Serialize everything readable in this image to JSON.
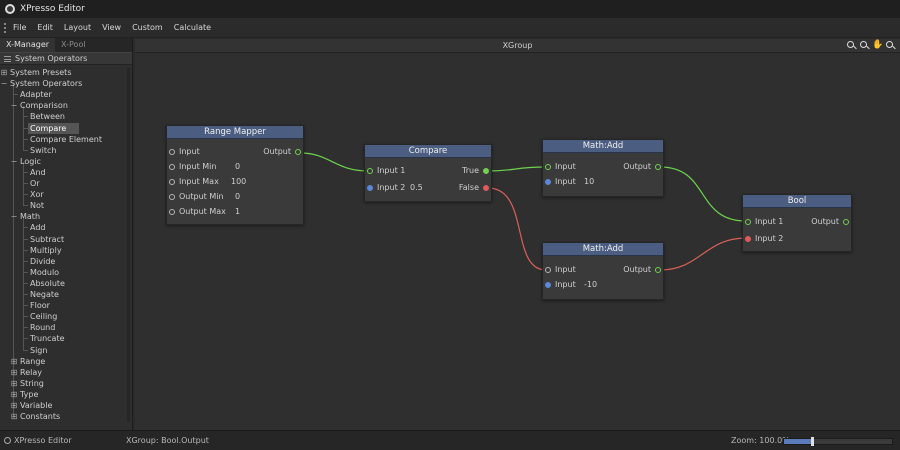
{
  "app": {
    "title": "XPresso Editor"
  },
  "menu": [
    "File",
    "Edit",
    "Layout",
    "View",
    "Custom",
    "Calculate"
  ],
  "left_panel": {
    "tabs": [
      {
        "label": "X-Manager",
        "active": true
      },
      {
        "label": "X-Pool",
        "active": false
      }
    ],
    "header": "System Operators",
    "tree": [
      {
        "label": "System Presets",
        "level": 1,
        "toggle": "plus"
      },
      {
        "label": "System Operators",
        "level": 1,
        "toggle": "minus"
      },
      {
        "label": "Adapter",
        "level": 2
      },
      {
        "label": "Comparison",
        "level": 2,
        "toggle": "minus"
      },
      {
        "label": "Between",
        "level": 3
      },
      {
        "label": "Compare",
        "level": 3,
        "selected": true
      },
      {
        "label": "Compare Element",
        "level": 3
      },
      {
        "label": "Switch",
        "level": 3
      },
      {
        "label": "Logic",
        "level": 2,
        "toggle": "minus"
      },
      {
        "label": "And",
        "level": 3
      },
      {
        "label": "Or",
        "level": 3
      },
      {
        "label": "Xor",
        "level": 3
      },
      {
        "label": "Not",
        "level": 3
      },
      {
        "label": "Math",
        "level": 2,
        "toggle": "minus"
      },
      {
        "label": "Add",
        "level": 3
      },
      {
        "label": "Subtract",
        "level": 3
      },
      {
        "label": "Multiply",
        "level": 3
      },
      {
        "label": "Divide",
        "level": 3
      },
      {
        "label": "Modulo",
        "level": 3
      },
      {
        "label": "Absolute",
        "level": 3
      },
      {
        "label": "Negate",
        "level": 3
      },
      {
        "label": "Floor",
        "level": 3
      },
      {
        "label": "Ceiling",
        "level": 3
      },
      {
        "label": "Round",
        "level": 3
      },
      {
        "label": "Truncate",
        "level": 3
      },
      {
        "label": "Sign",
        "level": 3
      },
      {
        "label": "Range",
        "level": 2,
        "toggle": "plus"
      },
      {
        "label": "Relay",
        "level": 2,
        "toggle": "plus"
      },
      {
        "label": "String",
        "level": 2,
        "toggle": "plus"
      },
      {
        "label": "Type",
        "level": 2,
        "toggle": "plus"
      },
      {
        "label": "Variable",
        "level": 2,
        "toggle": "plus"
      },
      {
        "label": "Constants",
        "level": 2,
        "toggle": "plus"
      }
    ]
  },
  "graph": {
    "title": "XGroup",
    "tools": [
      "zoom-out-icon",
      "zoom-in-icon",
      "hand-icon",
      "zoom-fit-icon"
    ],
    "nodes": {
      "range_mapper": {
        "title": "Range Mapper",
        "inputs": [
          {
            "label": "Input",
            "value": ""
          },
          {
            "label": "Input Min",
            "value": "0"
          },
          {
            "label": "Input Max",
            "value": "100"
          },
          {
            "label": "Output Min",
            "value": "0"
          },
          {
            "label": "Output Max",
            "value": "1"
          }
        ],
        "output": "Output"
      },
      "compare": {
        "title": "Compare",
        "inputs": [
          {
            "label": "Input 1",
            "value": ""
          },
          {
            "label": "Input 2",
            "value": "0.5"
          }
        ],
        "outputs": [
          "True",
          "False"
        ]
      },
      "math_add_1": {
        "title": "Math:Add",
        "inputs": [
          {
            "label": "Input",
            "value": ""
          },
          {
            "label": "Input",
            "value": "10"
          }
        ],
        "output": "Output"
      },
      "math_add_2": {
        "title": "Math:Add",
        "inputs": [
          {
            "label": "Input",
            "value": ""
          },
          {
            "label": "Input",
            "value": "-10"
          }
        ],
        "output": "Output"
      },
      "bool": {
        "title": "Bool",
        "inputs": [
          {
            "label": "Input 1",
            "value": ""
          },
          {
            "label": "Input 2",
            "value": ""
          }
        ],
        "output": "Output"
      }
    },
    "wire_colors": {
      "true_path": "#6fd34e",
      "false_path": "#d9605a"
    }
  },
  "status": {
    "left": "XPresso Editor",
    "path": "XGroup: Bool.Output",
    "zoom_label": "Zoom: 100.0%",
    "zoom_fraction": 0.25
  }
}
